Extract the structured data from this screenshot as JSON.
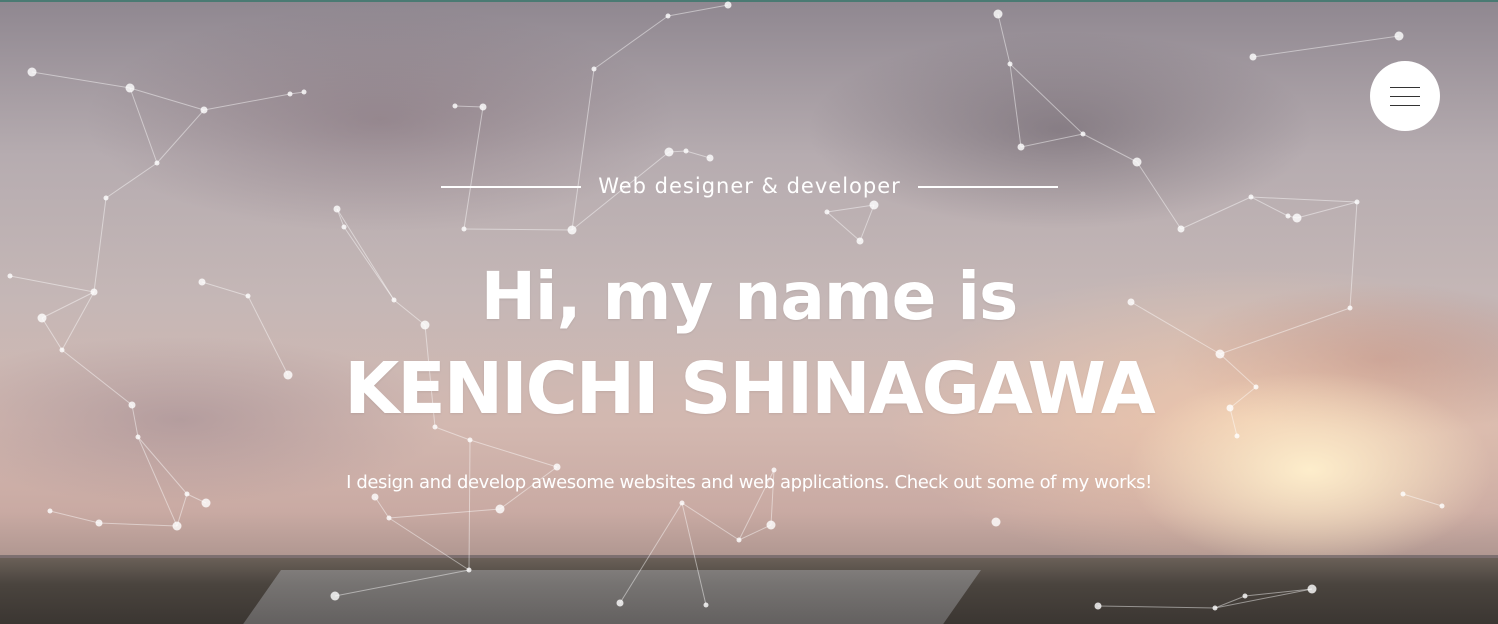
{
  "hero": {
    "subtitle": "Web designer & developer",
    "title_line1": "Hi, my name is",
    "title_line2": "KENICHI SHINAGAWA",
    "description": "I design and develop awesome websites and web applications. Check out some of my works!"
  },
  "menu": {
    "icon": "hamburger-menu-icon"
  },
  "colors": {
    "text": "#ffffff",
    "menu_bg": "#ffffff",
    "menu_icon": "#333333",
    "top_border": "#4a7a73"
  }
}
